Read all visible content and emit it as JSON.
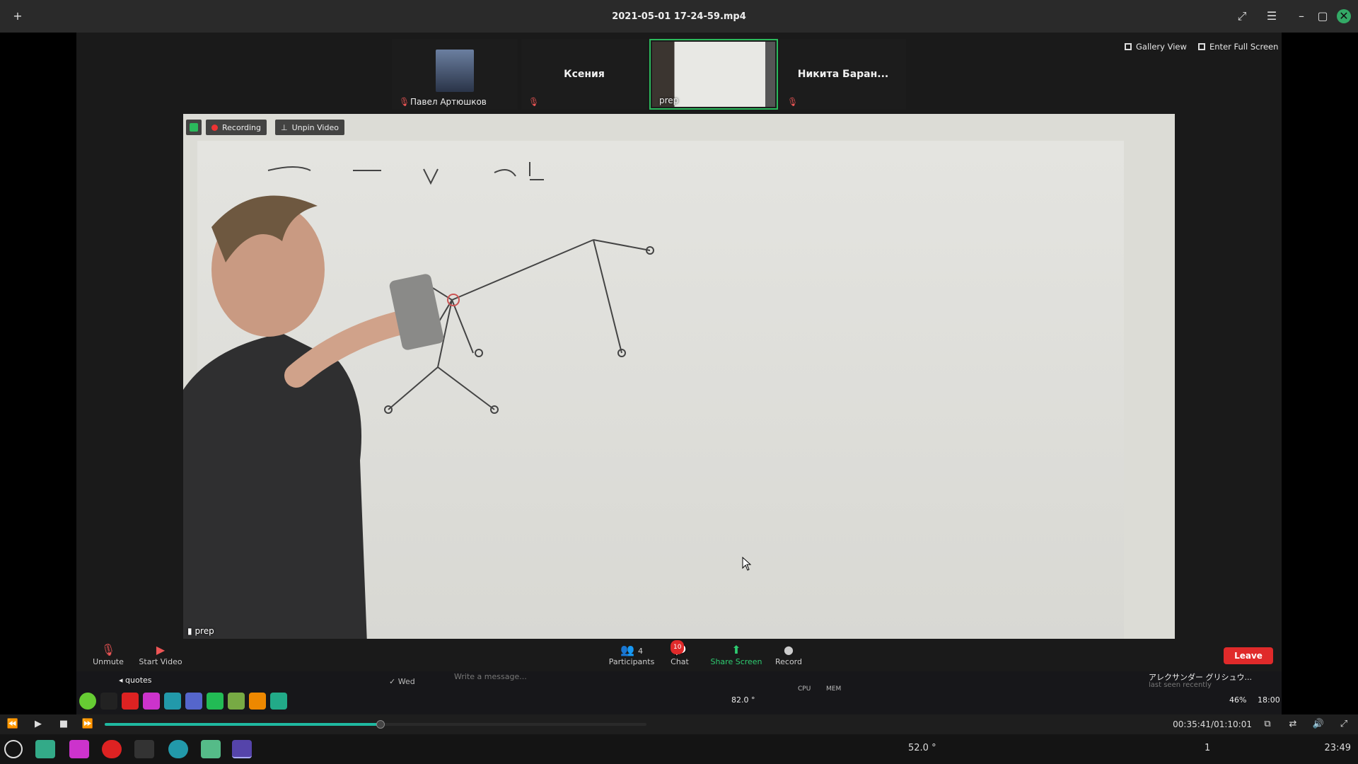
{
  "player": {
    "title": "2021-05-01 17-24-59.mp4",
    "current_time": "00:35:41/01:10:01",
    "progress_fraction": 0.509
  },
  "zoom": {
    "gallery_view": "Gallery View",
    "enter_full_screen": "Enter Full Screen",
    "participants": [
      {
        "name": "Павел Артюшков"
      },
      {
        "name": "Ксения"
      },
      {
        "name": "prep"
      },
      {
        "name": "Никита Баран..."
      }
    ],
    "recording_label": "Recording",
    "unpin_label": "Unpin Video",
    "speaker_name": "prep",
    "controls": {
      "unmute": "Unmute",
      "start_video": "Start Video",
      "participants": "Participants",
      "participants_count": "4",
      "chat": "Chat",
      "chat_badge": "10",
      "share_screen": "Share Screen",
      "record": "Record",
      "leave": "Leave"
    }
  },
  "inner_desktop": {
    "quotes_label": "quotes",
    "day_label": "Wed",
    "message_placeholder": "Write a message...",
    "contact_name": "アレクサンダー グリシュウ...",
    "contact_status": "last seen recently",
    "temp": "82.0 °",
    "cpu_label": "CPU",
    "mem_label": "MEM",
    "battery": "46%",
    "clock": "18:00"
  },
  "taskbar": {
    "temp": "52.0 °",
    "clock": "23:49",
    "workspace": "1"
  }
}
